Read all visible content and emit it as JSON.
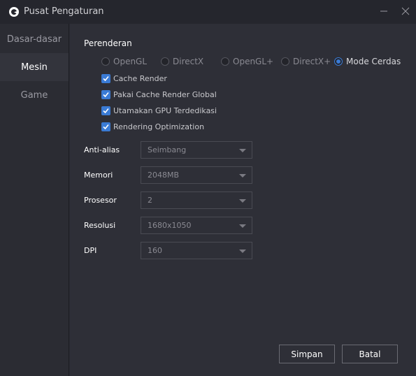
{
  "window": {
    "title": "Pusat Pengaturan"
  },
  "sidebar": {
    "items": [
      {
        "label": "Dasar-dasar",
        "active": false
      },
      {
        "label": "Mesin",
        "active": true
      },
      {
        "label": "Game",
        "active": false
      }
    ]
  },
  "rendering": {
    "section_label": "Perenderan",
    "modes": [
      {
        "label": "OpenGL",
        "checked": false
      },
      {
        "label": "DirectX",
        "checked": false
      },
      {
        "label": "OpenGL+",
        "checked": false
      },
      {
        "label": "DirectX+",
        "checked": false
      },
      {
        "label": "Mode Cerdas",
        "checked": true
      }
    ],
    "options": [
      {
        "label": "Cache Render",
        "checked": true
      },
      {
        "label": "Pakai Cache Render Global",
        "checked": true
      },
      {
        "label": "Utamakan GPU Terdedikasi",
        "checked": true
      },
      {
        "label": "Rendering Optimization",
        "checked": true
      }
    ]
  },
  "fields": {
    "antialias": {
      "label": "Anti-alias",
      "value": "Seimbang"
    },
    "memory": {
      "label": "Memori",
      "value": "2048MB"
    },
    "processor": {
      "label": "Prosesor",
      "value": "2"
    },
    "resolution": {
      "label": "Resolusi",
      "value": "1680x1050"
    },
    "dpi": {
      "label": "DPI",
      "value": "160"
    }
  },
  "buttons": {
    "save": "Simpan",
    "cancel": "Batal"
  },
  "colors": {
    "accent": "#3a7bd5",
    "background": "#2e2f37",
    "titlebar": "#25262d"
  }
}
